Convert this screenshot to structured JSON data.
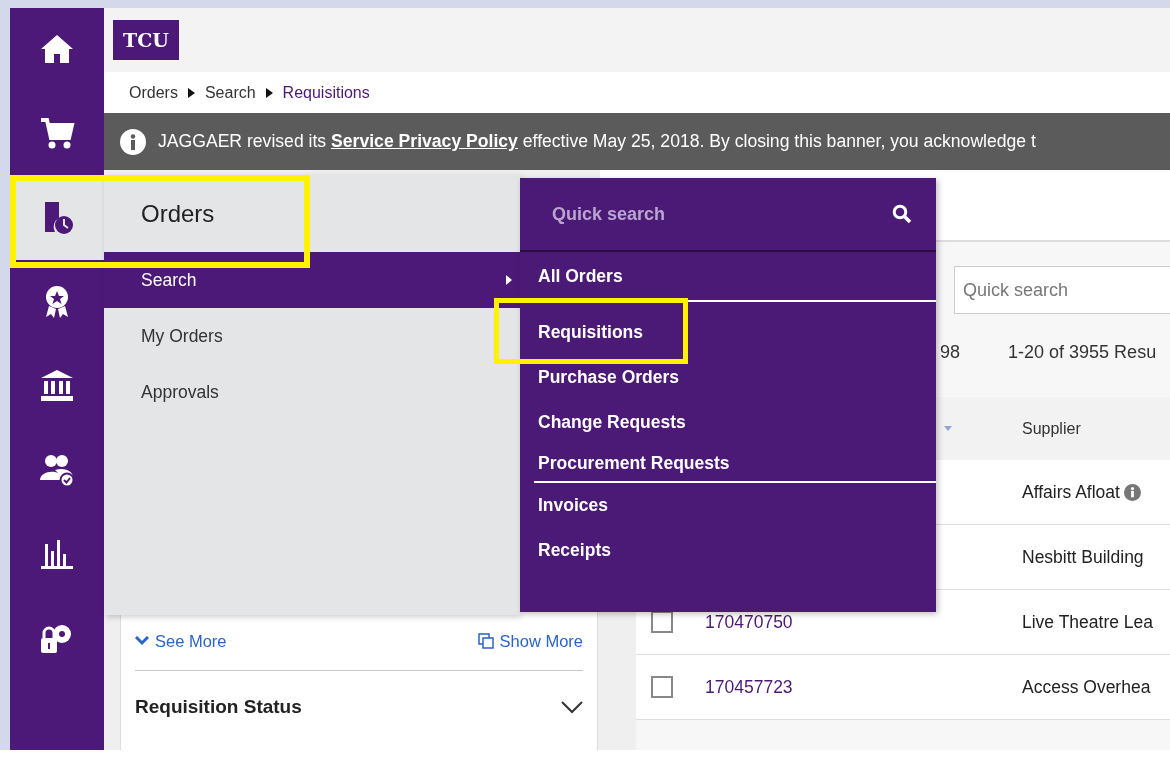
{
  "nav_rail": {
    "items": [
      {
        "selected": false
      },
      {
        "selected": false
      },
      {
        "selected": true
      },
      {
        "selected": false
      },
      {
        "selected": false
      },
      {
        "selected": false
      },
      {
        "selected": false
      },
      {
        "selected": false
      }
    ]
  },
  "header": {
    "logo": "TCU"
  },
  "breadcrumb": [
    {
      "label": "Orders",
      "current": false
    },
    {
      "label": "Search",
      "current": false
    },
    {
      "label": "Requisitions",
      "current": true
    }
  ],
  "banner": {
    "text": "JAGGAER revised its **Service Privacy Policy** effective May 25, 2018. By closing this banner, you acknowledge t"
  },
  "flyout": {
    "title": "Orders",
    "items": [
      {
        "label": "Search",
        "selected": true,
        "has_submenu": true
      },
      {
        "label": "My Orders",
        "selected": false,
        "has_submenu": false
      },
      {
        "label": "Approvals",
        "selected": false,
        "has_submenu": false
      }
    ]
  },
  "submenu": {
    "search": {
      "placeholder": "Quick search"
    },
    "groups": [
      {
        "items": [
          "All Orders"
        ]
      },
      {
        "items": [
          "Requisitions",
          "Purchase Orders",
          "Change Requests",
          "Procurement Requests"
        ]
      },
      {
        "items": [
          "Invoices",
          "Receipts"
        ]
      }
    ]
  },
  "filter_panel": {
    "see_more": "See More",
    "show_more": "Show More",
    "section": {
      "title": "Requisition Status",
      "expanded": false
    }
  },
  "results": {
    "search": {
      "placeholder": "Quick search"
    },
    "count_fragment": "98",
    "range": "1-20 of 3955 Resu"
  },
  "table": {
    "columns": [
      "Supplier"
    ],
    "rows": [
      {
        "supplier": "Affairs Afloat",
        "info": true
      },
      {
        "supplier": "Nesbitt Building",
        "info": false
      },
      {
        "checked": false,
        "number": "170470750",
        "supplier": "Live Theatre Lea",
        "info": false
      },
      {
        "checked": false,
        "number": "170457723",
        "supplier": "Access Overhea",
        "info": false
      }
    ]
  }
}
